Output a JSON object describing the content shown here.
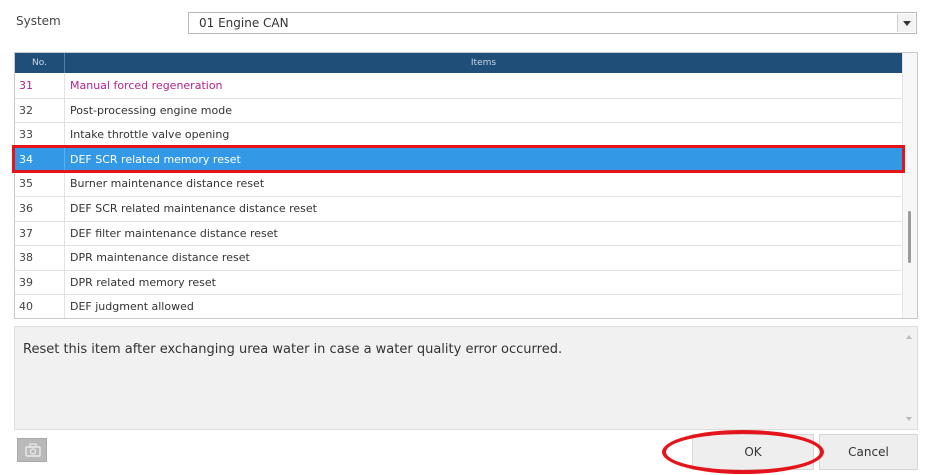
{
  "system": {
    "label": "System",
    "selected": "01 Engine CAN"
  },
  "table": {
    "headers": {
      "no": "No.",
      "items": "Items"
    },
    "rows": [
      {
        "no": "31",
        "item": "Manual forced regeneration"
      },
      {
        "no": "32",
        "item": "Post-processing engine mode"
      },
      {
        "no": "33",
        "item": "Intake throttle valve opening"
      },
      {
        "no": "34",
        "item": "DEF SCR related memory reset"
      },
      {
        "no": "35",
        "item": "Burner maintenance distance reset"
      },
      {
        "no": "36",
        "item": "DEF SCR related maintenance distance reset"
      },
      {
        "no": "37",
        "item": "DEF filter maintenance distance reset"
      },
      {
        "no": "38",
        "item": "DPR maintenance distance reset"
      },
      {
        "no": "39",
        "item": "DPR related memory reset"
      },
      {
        "no": "40",
        "item": "DEF judgment allowed"
      }
    ]
  },
  "description": "Reset this item after exchanging urea water in case a water quality error occurred.",
  "buttons": {
    "ok": "OK",
    "cancel": "Cancel"
  },
  "icons": {
    "camera": "camera-icon",
    "dropdown": "chevron-down-icon"
  },
  "colors": {
    "header_bg": "#1f4e79",
    "selected_bg": "#3399e6",
    "annotation_red": "#e4141b",
    "magenta_text": "#b2228c"
  }
}
